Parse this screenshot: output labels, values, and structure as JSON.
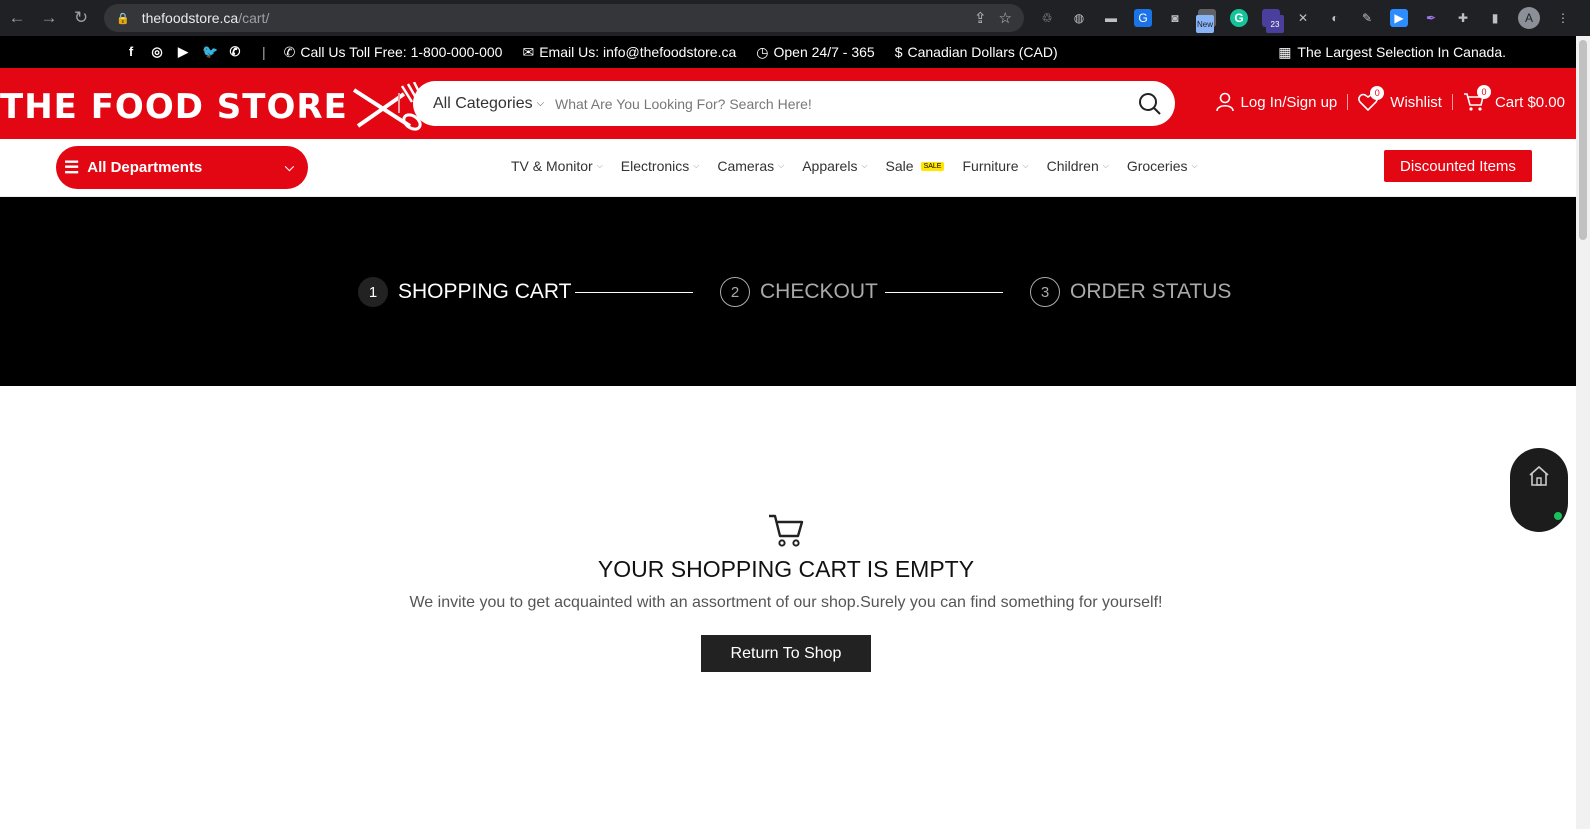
{
  "browser": {
    "url_host": "thefoodstore.ca",
    "url_path": "/cart/",
    "ext_new_badge": "New",
    "ext_count_badge": "23",
    "profile_initial": "A"
  },
  "topbar": {
    "call": "Call Us Toll Free: 1-800-000-000",
    "email": "Email Us: info@thefoodstore.ca",
    "hours": "Open 24/7 - 365",
    "currency": "Canadian Dollars (CAD)",
    "currency_symbol": "$",
    "tagline": "The Largest Selection In Canada."
  },
  "header": {
    "logo": "THE FOOD STORE",
    "categories": "All Categories",
    "search_placeholder": "What Are You Looking For? Search Here!",
    "login": "Log In/Sign up",
    "wishlist": "Wishlist",
    "wishlist_count": "0",
    "cart": "Cart $0.00",
    "cart_count": "0"
  },
  "nav": {
    "departments": "All Departments",
    "items": [
      {
        "label": "TV & Monitor"
      },
      {
        "label": "Electronics"
      },
      {
        "label": "Cameras"
      },
      {
        "label": "Apparels"
      },
      {
        "label": "Sale",
        "tag": "SALE"
      },
      {
        "label": "Furniture"
      },
      {
        "label": "Children"
      },
      {
        "label": "Groceries"
      }
    ],
    "discounted": "Discounted Items"
  },
  "steps": [
    {
      "num": "1",
      "label": "SHOPPING CART"
    },
    {
      "num": "2",
      "label": "CHECKOUT"
    },
    {
      "num": "3",
      "label": "ORDER STATUS"
    }
  ],
  "empty_cart": {
    "title": "YOUR SHOPPING CART IS EMPTY",
    "subtitle": "We invite you to get acquainted with an assortment of our shop.Surely you can find something for yourself!",
    "button": "Return To Shop"
  },
  "colors": {
    "brand_red": "#e30613",
    "dark": "#000000"
  }
}
